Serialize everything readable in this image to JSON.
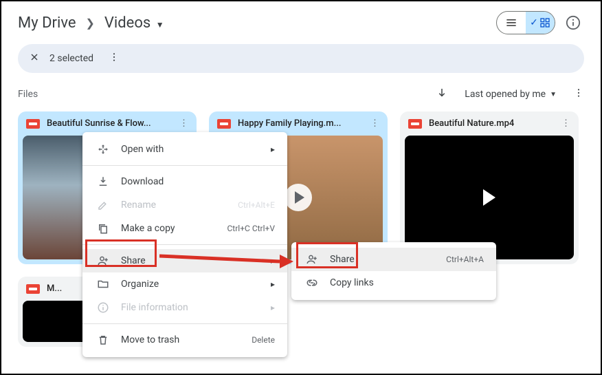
{
  "breadcrumb": {
    "root": "My Drive",
    "folder": "Videos"
  },
  "selection": {
    "count_text": "2 selected"
  },
  "files_section": {
    "label": "Files",
    "sort_label": "Last opened by me"
  },
  "cards": [
    {
      "title": "Beautiful Sunrise & Flow...",
      "selected": true,
      "thumb_class": "sunset",
      "play_style": "none"
    },
    {
      "title": "Happy Family Playing.m...",
      "selected": true,
      "thumb_class": "family",
      "play_style": "circle"
    },
    {
      "title": "Beautiful Nature.mp4",
      "selected": false,
      "thumb_class": "",
      "play_style": "triangle"
    },
    {
      "title": "M...",
      "selected": false,
      "thumb_class": "",
      "play_style": "none"
    }
  ],
  "context_menu": {
    "open_with": "Open with",
    "download": "Download",
    "rename": "Rename",
    "rename_shortcut": "Ctrl+Alt+E",
    "make_copy": "Make a copy",
    "make_copy_shortcut": "Ctrl+C Ctrl+V",
    "share": "Share",
    "organize": "Organize",
    "file_info": "File information",
    "move_trash": "Move to trash",
    "delete_label": "Delete"
  },
  "share_submenu": {
    "share": "Share",
    "share_shortcut": "Ctrl+Alt+A",
    "copy_links": "Copy links"
  }
}
